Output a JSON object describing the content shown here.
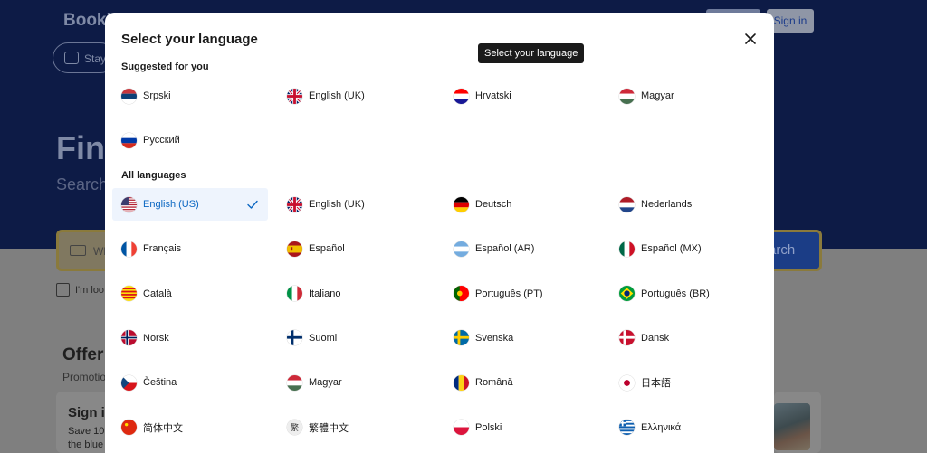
{
  "background": {
    "logo": "Booki",
    "stays_label": "Stay",
    "signin_label": "Sign in",
    "hero_title": "Fin",
    "hero_subtitle": "Search",
    "search_placeholder": "Wh",
    "search_button": "arch",
    "checkbox_label": "I'm loo",
    "offers_title": "Offer",
    "promo_text": "Promotio",
    "card_title": "Sign i",
    "card_text_1": "Save 10",
    "card_text_2": "the blue"
  },
  "modal": {
    "title": "Select your language",
    "tooltip": "Select your language",
    "suggested_title": "Suggested for you",
    "all_title": "All languages",
    "suggested": [
      {
        "label": "Srpski",
        "flag": "rs"
      },
      {
        "label": "English (UK)",
        "flag": "gb"
      },
      {
        "label": "Hrvatski",
        "flag": "hr"
      },
      {
        "label": "Magyar",
        "flag": "hu"
      },
      {
        "label": "Русский",
        "flag": "ru"
      }
    ],
    "all": [
      {
        "label": "English (US)",
        "flag": "us",
        "selected": true
      },
      {
        "label": "English (UK)",
        "flag": "gb"
      },
      {
        "label": "Deutsch",
        "flag": "de"
      },
      {
        "label": "Nederlands",
        "flag": "nl"
      },
      {
        "label": "Français",
        "flag": "fr"
      },
      {
        "label": "Español",
        "flag": "es"
      },
      {
        "label": "Español (AR)",
        "flag": "ar"
      },
      {
        "label": "Español (MX)",
        "flag": "mx"
      },
      {
        "label": "Català",
        "flag": "ct"
      },
      {
        "label": "Italiano",
        "flag": "it"
      },
      {
        "label": "Português (PT)",
        "flag": "pt"
      },
      {
        "label": "Português (BR)",
        "flag": "br"
      },
      {
        "label": "Norsk",
        "flag": "no"
      },
      {
        "label": "Suomi",
        "flag": "fi"
      },
      {
        "label": "Svenska",
        "flag": "se"
      },
      {
        "label": "Dansk",
        "flag": "dk"
      },
      {
        "label": "Čeština",
        "flag": "cz"
      },
      {
        "label": "Magyar",
        "flag": "hu"
      },
      {
        "label": "Română",
        "flag": "ro"
      },
      {
        "label": "日本語",
        "flag": "jp"
      },
      {
        "label": "简体中文",
        "flag": "cn"
      },
      {
        "label": "繁體中文",
        "flag": "tw"
      },
      {
        "label": "Polski",
        "flag": "pl"
      },
      {
        "label": "Ελληνικά",
        "flag": "gr"
      }
    ]
  },
  "colors": {
    "brand_dark": "#0d1b46",
    "selected_bg": "#eef4fd",
    "selected_text": "#0a66c2"
  }
}
